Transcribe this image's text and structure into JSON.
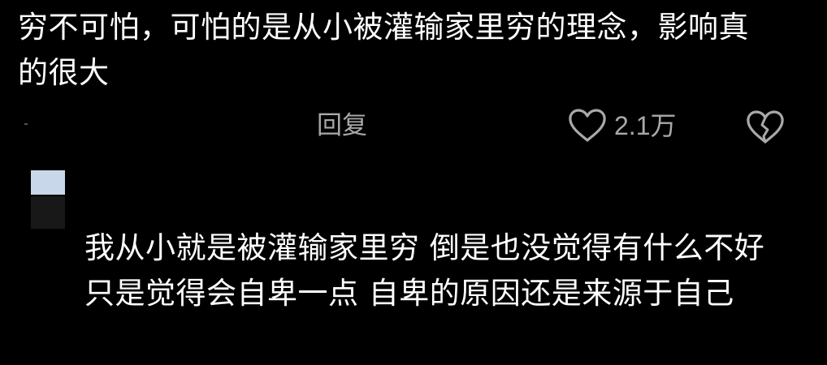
{
  "comment": {
    "text": "穷不可怕，可怕的是从小被灌输家里穷的理念，影响真的很大"
  },
  "actions": {
    "reply_label": "回复",
    "like_icon": "heart-outline-icon",
    "like_count": "2.1万",
    "dislike_icon": "broken-heart-icon",
    "icon_color": "#a9a9a9"
  },
  "reply": {
    "avatar_colors": [
      "#c8d8ea",
      "#181818"
    ],
    "text": "我从小就是被灌输家里穷 倒是也没觉得有什么不好 只是觉得会自卑一点 自卑的原因还是来源于自己"
  }
}
